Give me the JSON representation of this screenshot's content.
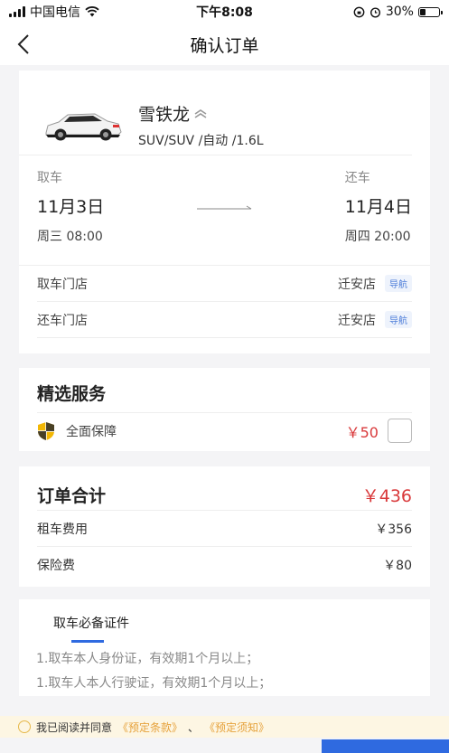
{
  "status_bar": {
    "carrier": "中国电信",
    "time": "下午8:08",
    "battery": "30%",
    "battery_level": 0.3
  },
  "nav": {
    "title": "确认订单"
  },
  "car": {
    "name": "雪铁龙",
    "spec": "SUV/SUV /自动 /1.6L"
  },
  "trip": {
    "pickup": {
      "label": "取车",
      "date": "11月3日",
      "time": "周三 08:00"
    },
    "return": {
      "label": "还车",
      "date": "11月4日",
      "time": "周四 20:00"
    }
  },
  "stores": [
    {
      "label": "取车门店",
      "store": "迁安店",
      "nav": "导航"
    },
    {
      "label": "还车门店",
      "store": "迁安店",
      "nav": "导航"
    }
  ],
  "services": {
    "title": "精选服务",
    "items": [
      {
        "name": "全面保障",
        "price": "￥50"
      }
    ]
  },
  "total": {
    "title": "订单合计",
    "amount": "￥436",
    "fees": [
      {
        "label": "租车费用",
        "amount": "￥356"
      },
      {
        "label": "保险费",
        "amount": "￥80"
      }
    ]
  },
  "documents": {
    "tab": "取车必备证件",
    "lines": [
      "1.取车本人身份证，有效期1个月以上；",
      "1.取车人本人行驶证，有效期1个月以上；"
    ]
  },
  "agreement": {
    "prefix": "我已阅读并同意",
    "terms": "《预定条款》",
    "sep": "、",
    "notice": "《预定须知》"
  },
  "colors": {
    "accent": "#2f6ae0",
    "price": "#d9393b",
    "shield": "#f2b705"
  }
}
